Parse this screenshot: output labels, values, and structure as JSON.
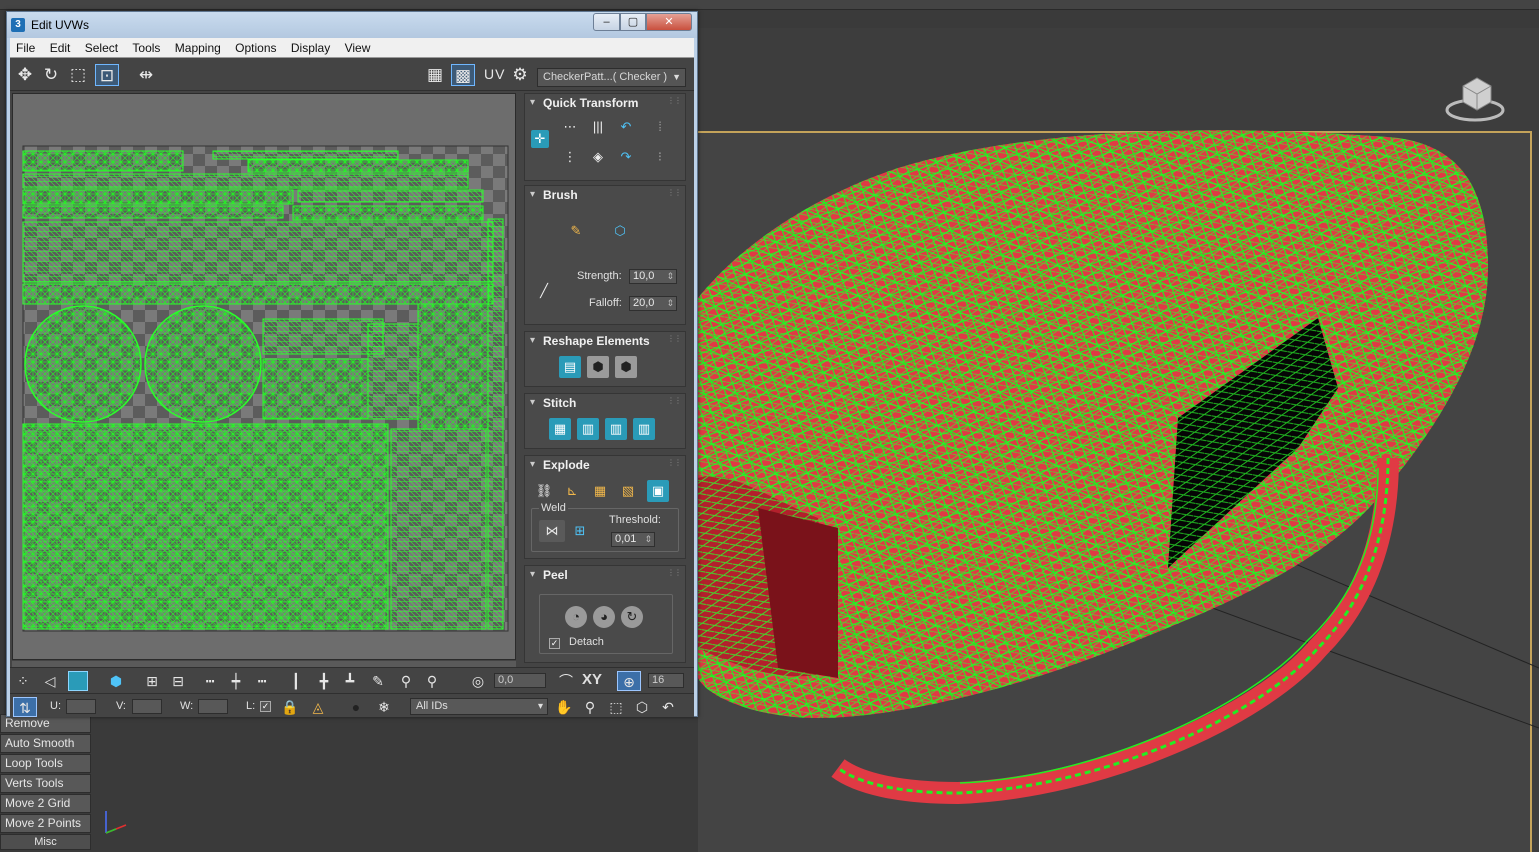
{
  "window": {
    "title": "Edit UVWs",
    "app_icon": "3",
    "min": "–",
    "max": "▢",
    "close": "✕"
  },
  "menu": [
    "File",
    "Edit",
    "Select",
    "Tools",
    "Mapping",
    "Options",
    "Display",
    "View"
  ],
  "toolbar": {
    "uv_label": "UV",
    "checker_dropdown": "CheckerPatt...( Checker )"
  },
  "rollouts": {
    "quick_transform": "Quick Transform",
    "brush": {
      "title": "Brush",
      "strength_label": "Strength:",
      "strength_value": "10,0",
      "falloff_label": "Falloff:",
      "falloff_value": "20,0"
    },
    "reshape": "Reshape Elements",
    "stitch": "Stitch",
    "explode": {
      "title": "Explode",
      "weld_label": "Weld",
      "threshold_label": "Threshold:",
      "threshold_value": "0,01"
    },
    "peel": {
      "title": "Peel",
      "detach_label": "Detach"
    }
  },
  "bottom": {
    "angle_value": "0,0",
    "xy_label": "XY",
    "grid_value": "16",
    "u_label": "U:",
    "v_label": "V:",
    "w_label": "W:",
    "l_label": "L:",
    "ids_dropdown": "All IDs"
  },
  "commands": [
    "Remove",
    "Auto Smooth",
    "Loop Tools",
    "Verts Tools",
    "Move 2 Grid",
    "Move 2 Points",
    "Misc"
  ],
  "colors": {
    "wire": "#22ee22",
    "mesh": "#e03a44",
    "accent": "#2a9bb8"
  }
}
